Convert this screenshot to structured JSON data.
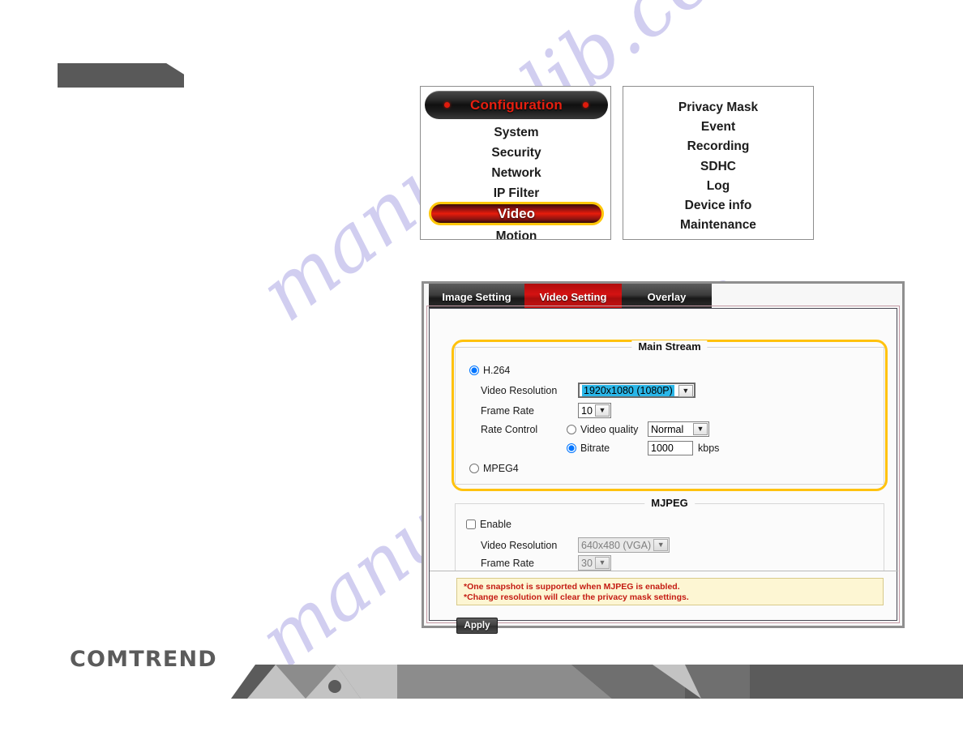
{
  "watermark": {
    "line1": "manualslib.com",
    "line2": "manualslib.com"
  },
  "brand": {
    "logo_text": "COMTREND"
  },
  "config_menu": {
    "title": "Configuration",
    "items": [
      {
        "label": "System",
        "selected": false
      },
      {
        "label": "Security",
        "selected": false
      },
      {
        "label": "Network",
        "selected": false
      },
      {
        "label": "IP Filter",
        "selected": false
      },
      {
        "label": "Video",
        "selected": true
      },
      {
        "label": "Motion",
        "selected": false
      }
    ]
  },
  "config_menu_2": {
    "items": [
      {
        "label": "Privacy Mask"
      },
      {
        "label": "Event"
      },
      {
        "label": "Recording"
      },
      {
        "label": "SDHC"
      },
      {
        "label": "Log"
      },
      {
        "label": "Device info"
      },
      {
        "label": "Maintenance"
      }
    ]
  },
  "settings": {
    "tabs": [
      {
        "label": "Image Setting",
        "active": false
      },
      {
        "label": "Video Setting",
        "active": true
      },
      {
        "label": "Overlay",
        "active": false
      }
    ],
    "main_stream": {
      "title": "Main Stream",
      "codec_h264_label": "H.264",
      "codec_h264_selected": true,
      "codec_mpeg4_label": "MPEG4",
      "codec_mpeg4_selected": false,
      "video_resolution_label": "Video Resolution",
      "video_resolution_value": "1920x1080 (1080P)",
      "frame_rate_label": "Frame Rate",
      "frame_rate_value": "10",
      "rate_control_label": "Rate Control",
      "video_quality_label": "Video quality",
      "video_quality_selected": false,
      "video_quality_value": "Normal",
      "bitrate_label": "Bitrate",
      "bitrate_selected": true,
      "bitrate_value": "1000",
      "bitrate_unit": "kbps"
    },
    "mjpeg": {
      "title": "MJPEG",
      "enable_label": "Enable",
      "enable_checked": false,
      "video_resolution_label": "Video Resolution",
      "video_resolution_value": "640x480 (VGA)",
      "frame_rate_label": "Frame Rate",
      "frame_rate_value": "30"
    },
    "notes": [
      "*One snapshot is supported when MJPEG is enabled.",
      "*Change resolution will clear the privacy mask settings."
    ],
    "apply_label": "Apply"
  },
  "colors": {
    "accent_red": "#e61f10",
    "highlight_yellow": "#ffc20e",
    "tab_active_red": "#c51212",
    "note_text": "#c41b12",
    "select_highlight": "#2ab6e8",
    "banner_gray": "#5b5b5b"
  }
}
